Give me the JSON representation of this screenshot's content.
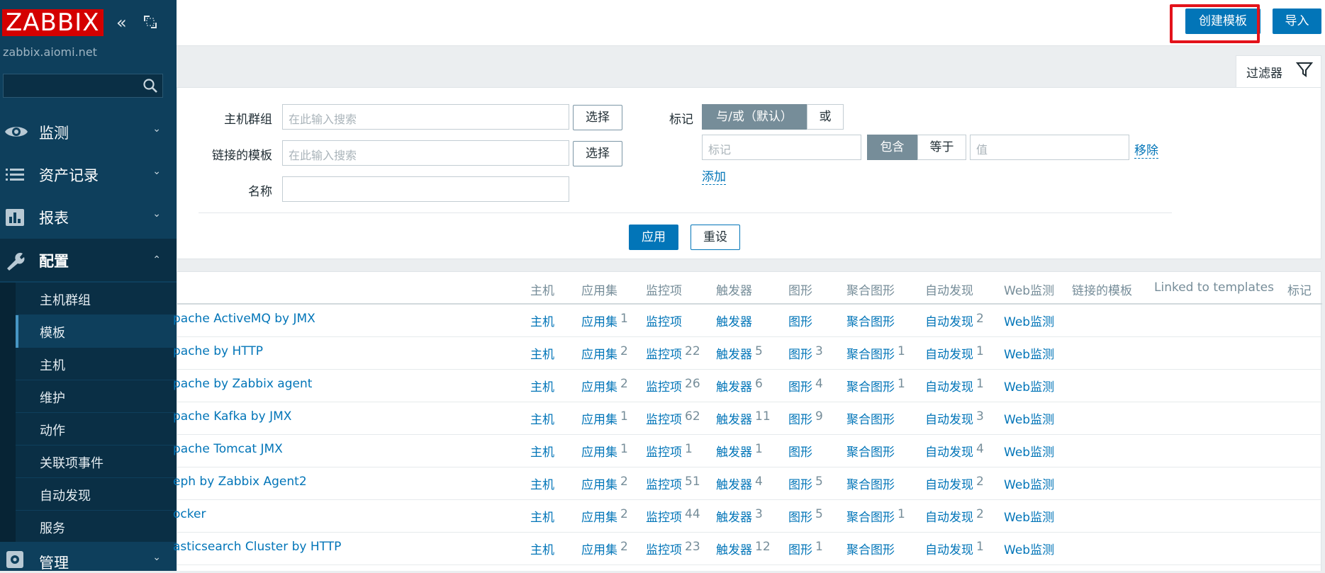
{
  "sidebar": {
    "logo": "ZABBIX",
    "server": "zabbix.aiomi.net",
    "search_placeholder": "",
    "menu": [
      {
        "label": "监测",
        "icon": "eye-icon"
      },
      {
        "label": "资产记录",
        "icon": "list-icon"
      },
      {
        "label": "报表",
        "icon": "bar-chart-icon"
      },
      {
        "label": "配置",
        "icon": "wrench-icon"
      },
      {
        "label": "管理",
        "icon": "gear-icon"
      }
    ],
    "submenu": [
      "主机群组",
      "模板",
      "主机",
      "维护",
      "动作",
      "关联项事件",
      "自动发现",
      "服务"
    ],
    "selected_submenu": "模板"
  },
  "header": {
    "create_button": "创建模板",
    "import_button": "导入"
  },
  "filter": {
    "tab_label": "过滤器",
    "host_group_label": "主机群组",
    "host_group_placeholder": "在此输入搜索",
    "linked_templates_label": "链接的模板",
    "linked_templates_placeholder": "在此输入搜索",
    "select_label": "选择",
    "name_label": "名称",
    "name_value": "",
    "tags_label": "标记",
    "tag_mode_and_or": "与/或（默认）",
    "tag_mode_or": "或",
    "tag_placeholder": "标记",
    "op_contains": "包含",
    "op_equals": "等于",
    "value_placeholder": "值",
    "remove_link": "移除",
    "add_link": "添加",
    "apply_button": "应用",
    "reset_button": "重设"
  },
  "table": {
    "headers": {
      "hosts": "主机",
      "applications": "应用集",
      "items": "监控项",
      "triggers": "触发器",
      "graphs": "图形",
      "screens": "聚合图形",
      "discovery": "自动发现",
      "web": "Web监测",
      "linked_templates": "链接的模板",
      "linked_to": "Linked to templates",
      "tags": "标记"
    },
    "rows": [
      {
        "name": "pache ActiveMQ by JMX",
        "hosts": "主机",
        "apps": "应用集",
        "apps_n": "1",
        "items": "监控项",
        "items_n": "",
        "triggers": "触发器",
        "triggers_n": "",
        "graphs": "图形",
        "graphs_n": "",
        "screens": "聚合图形",
        "screens_n": "",
        "disc": "自动发现",
        "disc_n": "2",
        "web": "Web监测"
      },
      {
        "name": "pache by HTTP",
        "hosts": "主机",
        "apps": "应用集",
        "apps_n": "2",
        "items": "监控项",
        "items_n": "22",
        "triggers": "触发器",
        "triggers_n": "5",
        "graphs": "图形",
        "graphs_n": "3",
        "screens": "聚合图形",
        "screens_n": "1",
        "disc": "自动发现",
        "disc_n": "1",
        "web": "Web监测"
      },
      {
        "name": "pache by Zabbix agent",
        "hosts": "主机",
        "apps": "应用集",
        "apps_n": "2",
        "items": "监控项",
        "items_n": "26",
        "triggers": "触发器",
        "triggers_n": "6",
        "graphs": "图形",
        "graphs_n": "4",
        "screens": "聚合图形",
        "screens_n": "1",
        "disc": "自动发现",
        "disc_n": "1",
        "web": "Web监测"
      },
      {
        "name": "pache Kafka by JMX",
        "hosts": "主机",
        "apps": "应用集",
        "apps_n": "1",
        "items": "监控项",
        "items_n": "62",
        "triggers": "触发器",
        "triggers_n": "11",
        "graphs": "图形",
        "graphs_n": "9",
        "screens": "聚合图形",
        "screens_n": "",
        "disc": "自动发现",
        "disc_n": "3",
        "web": "Web监测"
      },
      {
        "name": "pache Tomcat JMX",
        "hosts": "主机",
        "apps": "应用集",
        "apps_n": "1",
        "items": "监控项",
        "items_n": "1",
        "triggers": "触发器",
        "triggers_n": "1",
        "graphs": "图形",
        "graphs_n": "",
        "screens": "聚合图形",
        "screens_n": "",
        "disc": "自动发现",
        "disc_n": "4",
        "web": "Web监测"
      },
      {
        "name": "eph by Zabbix Agent2",
        "hosts": "主机",
        "apps": "应用集",
        "apps_n": "2",
        "items": "监控项",
        "items_n": "51",
        "triggers": "触发器",
        "triggers_n": "4",
        "graphs": "图形",
        "graphs_n": "5",
        "screens": "聚合图形",
        "screens_n": "",
        "disc": "自动发现",
        "disc_n": "2",
        "web": "Web监测"
      },
      {
        "name": "ocker",
        "hosts": "主机",
        "apps": "应用集",
        "apps_n": "2",
        "items": "监控项",
        "items_n": "44",
        "triggers": "触发器",
        "triggers_n": "3",
        "graphs": "图形",
        "graphs_n": "5",
        "screens": "聚合图形",
        "screens_n": "1",
        "disc": "自动发现",
        "disc_n": "2",
        "web": "Web监测"
      },
      {
        "name": "asticsearch Cluster by HTTP",
        "hosts": "主机",
        "apps": "应用集",
        "apps_n": "2",
        "items": "监控项",
        "items_n": "23",
        "triggers": "触发器",
        "triggers_n": "12",
        "graphs": "图形",
        "graphs_n": "1",
        "screens": "聚合图形",
        "screens_n": "",
        "disc": "自动发现",
        "disc_n": "1",
        "web": "Web监测"
      }
    ]
  },
  "colors": {
    "sidebar_bg": "#0e3f5c",
    "brand_red": "#d40000",
    "link_blue": "#0275b8",
    "highlight_red": "#e3131b"
  }
}
